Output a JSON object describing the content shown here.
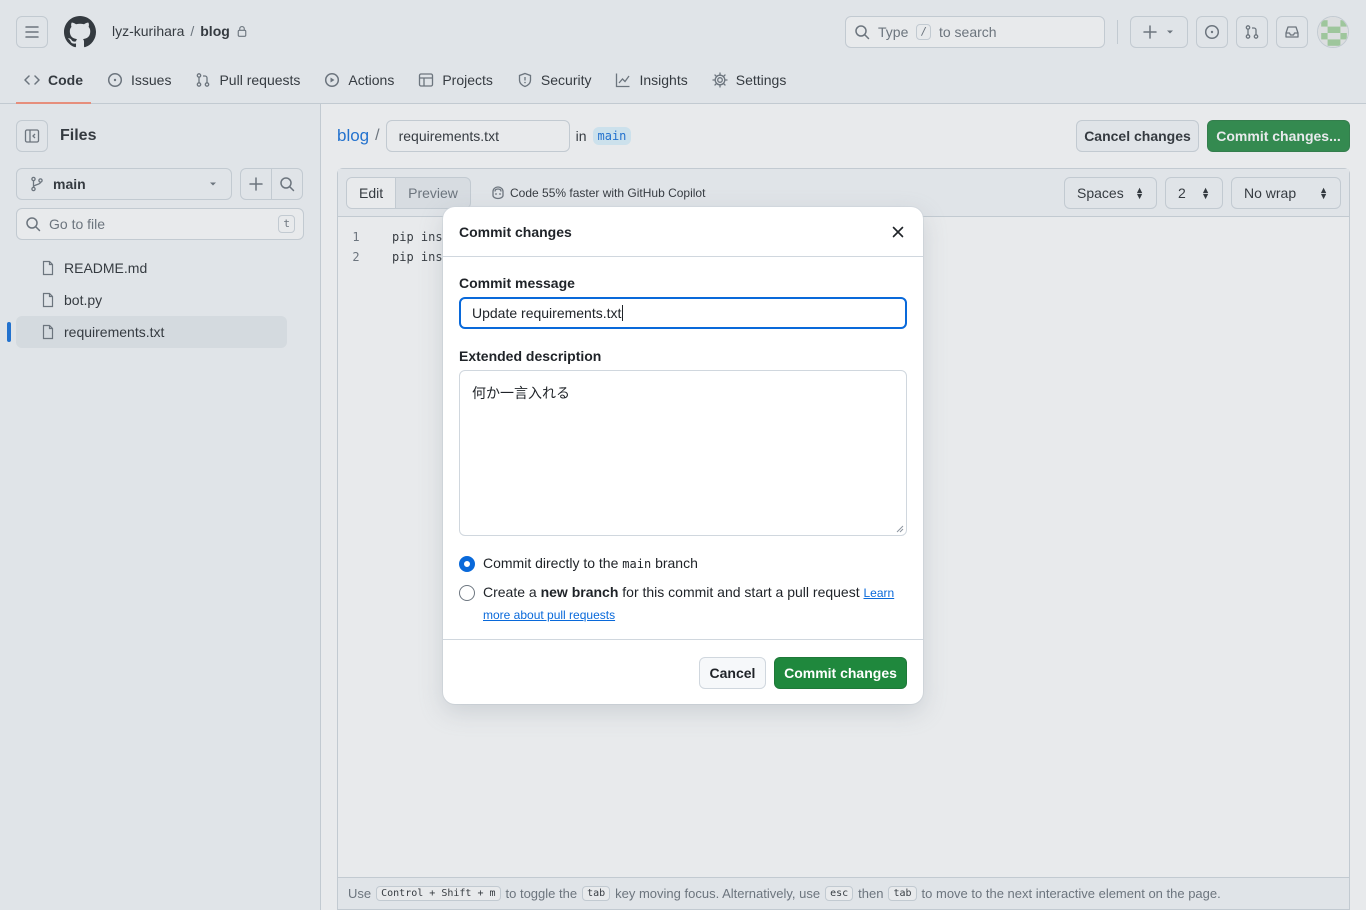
{
  "header": {
    "owner": "lyz-kurihara",
    "separator": "/",
    "repo": "blog",
    "search_prefix": "Type",
    "search_key": "/",
    "search_suffix": "to search"
  },
  "nav": {
    "tabs": [
      {
        "label": "Code",
        "icon": "code-icon"
      },
      {
        "label": "Issues",
        "icon": "issue-icon"
      },
      {
        "label": "Pull requests",
        "icon": "pull-request-icon"
      },
      {
        "label": "Actions",
        "icon": "play-icon"
      },
      {
        "label": "Projects",
        "icon": "table-icon"
      },
      {
        "label": "Security",
        "icon": "shield-icon"
      },
      {
        "label": "Insights",
        "icon": "graph-icon"
      },
      {
        "label": "Settings",
        "icon": "gear-icon"
      }
    ],
    "active": "Code"
  },
  "sidebar": {
    "title": "Files",
    "branch": "main",
    "goto_placeholder": "Go to file",
    "goto_key": "t",
    "files": [
      "README.md",
      "bot.py",
      "requirements.txt"
    ],
    "selected_file": "requirements.txt"
  },
  "editor": {
    "repo_link": "blog",
    "path_sep": "/",
    "filename": "requirements.txt",
    "in_label": "in",
    "branch": "main",
    "cancel_label": "Cancel changes",
    "commit_label": "Commit changes...",
    "edit_tab": "Edit",
    "preview_tab": "Preview",
    "copilot_text": "Code 55% faster with GitHub Copilot",
    "indent_mode": "Spaces",
    "indent_size": "2",
    "wrap_mode": "No wrap",
    "lines": [
      {
        "num": "1",
        "text": "pip inst"
      },
      {
        "num": "2",
        "text": "pip inst"
      }
    ],
    "footer": {
      "use": "Use",
      "k1": "Control + Shift + m",
      "t1": "to toggle the",
      "k2": "tab",
      "t2": "key moving focus. Alternatively, use",
      "k3": "esc",
      "t3": "then",
      "k4": "tab",
      "t4": "to move to the next interactive element on the page."
    }
  },
  "dialog": {
    "title": "Commit changes",
    "message_label": "Commit message",
    "message_value": "Update requirements.txt",
    "desc_label": "Extended description",
    "desc_value": "何か一言入れる",
    "opt1_pre": "Commit directly to the",
    "opt1_branch": "main",
    "opt1_post": "branch",
    "opt2_pre": "Create a",
    "opt2_bold": "new branch",
    "opt2_post": "for this commit and start a pull request",
    "opt2_link": "Learn more about pull requests",
    "selected_option": 1,
    "cancel": "Cancel",
    "commit": "Commit changes"
  },
  "colors": {
    "primary_green": "#1f883d",
    "accent_blue": "#0969da",
    "tab_underline": "#fd8c73"
  }
}
